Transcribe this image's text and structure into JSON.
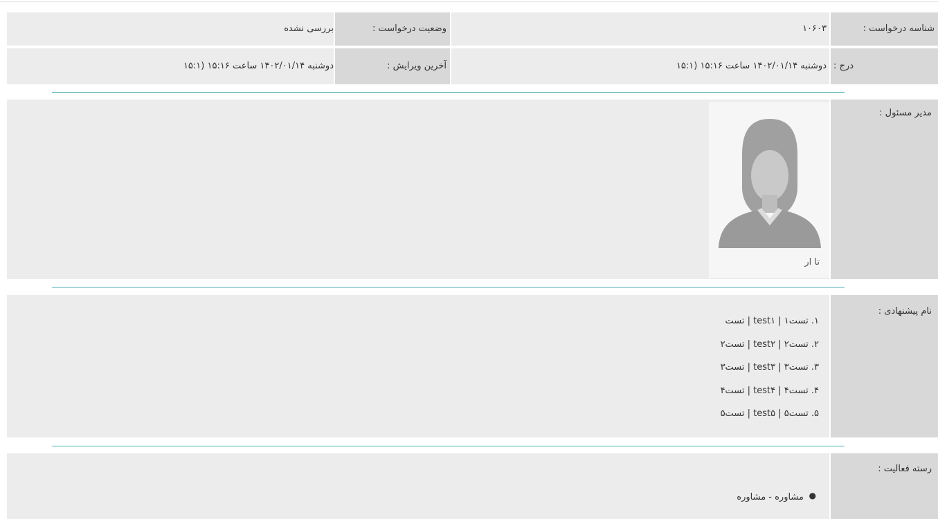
{
  "request": {
    "id_label": "شناسه درخواست :",
    "id_value": "۱۰۶۰۳",
    "status_label": "وضعیت درخواست :",
    "status_value": "بررسی نشده",
    "insert_label": "درج :",
    "insert_value": "دوشنبه ۱۴۰۲/۰۱/۱۴ ساعت ۱۵:۱۶ (۱۵:۱",
    "edit_label": "آخرین ویرایش :",
    "edit_value": "دوشنبه ۱۴۰۲/۰۱/۱۴ ساعت ۱۵:۱۶ (۱۵:۱"
  },
  "manager": {
    "label": "مدیر مسئول :",
    "name": "تا ار",
    "avatar_icon": "female-avatar-placeholder"
  },
  "suggested_names": {
    "label": "نام پیشنهادی :",
    "items": [
      "۱. تست۱ | test۱ | تست",
      "۲. تست۲ | test۲ | تست۲",
      "۳. تست۳ | test۳ | تست۳",
      "۴. تست۴ | test۴ | تست۴",
      "۵. تست۵ | test۵ | تست۵"
    ]
  },
  "activity": {
    "label": "رسته فعالیت :",
    "items": [
      "مشاوره - مشاوره"
    ]
  },
  "colors": {
    "label_bg": "#d8d8d8",
    "value_bg": "#ececec",
    "separator": "#4aaeb0"
  }
}
